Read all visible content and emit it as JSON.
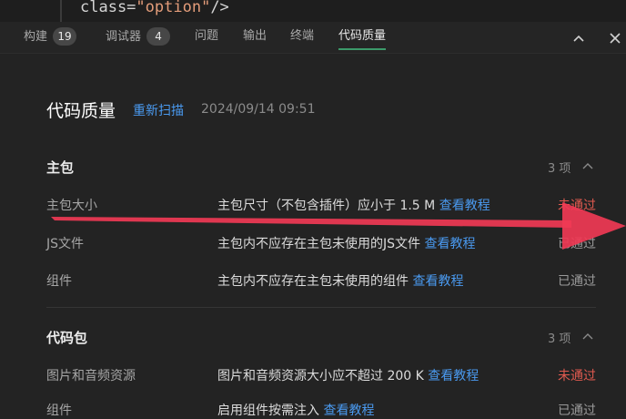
{
  "code": {
    "prefix": "class=",
    "value": "\"option\"",
    "suffix": "/>"
  },
  "tabs": [
    {
      "label": "构建",
      "badge": "19"
    },
    {
      "label": "调试器",
      "badge": "4"
    },
    {
      "label": "问题"
    },
    {
      "label": "输出"
    },
    {
      "label": "终端"
    },
    {
      "label": "代码质量",
      "active": true
    }
  ],
  "window_controls": {
    "collapse_icon": "chevron-up-icon",
    "close_icon": "close-icon"
  },
  "header": {
    "title": "代码质量",
    "rescan": "重新扫描",
    "timestamp": "2024/09/14 09:51"
  },
  "sections": [
    {
      "title": "主包",
      "count": "3 项",
      "rows": [
        {
          "name": "主包大小",
          "desc": "主包尺寸（不包含插件）应小于 1.5 M",
          "link": "查看教程",
          "status": "未通过",
          "state": "fail"
        },
        {
          "name": "JS文件",
          "desc": "主包内不应存在主包未使用的JS文件",
          "link": "查看教程",
          "status": "已通过",
          "state": "pass"
        },
        {
          "name": "组件",
          "desc": "主包内不应存在主包未使用的组件",
          "link": "查看教程",
          "status": "已通过",
          "state": "pass"
        }
      ]
    },
    {
      "title": "代码包",
      "count": "3 项",
      "rows": [
        {
          "name": "图片和音频资源",
          "desc": "图片和音频资源大小应不超过 200 K",
          "link": "查看教程",
          "status": "未通过",
          "state": "fail"
        },
        {
          "name": "组件",
          "desc": "启用组件按需注入",
          "link": "查看教程",
          "status": "已通过",
          "state": "pass"
        }
      ]
    }
  ],
  "colors": {
    "accent": "#4a9af0",
    "fail": "#e05a4f",
    "active_tab": "#3c9a6a",
    "annotation_arrow": "#f03a55"
  }
}
